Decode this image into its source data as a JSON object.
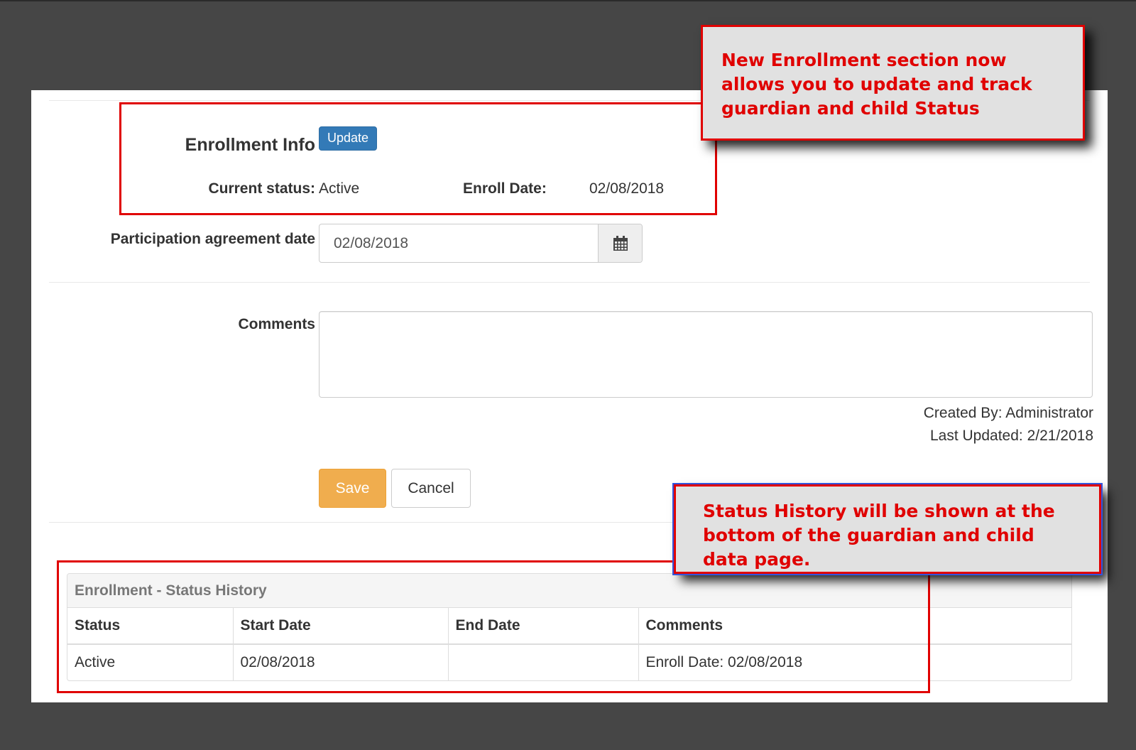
{
  "enrollment": {
    "title": "Enrollment Info",
    "update_label": "Update",
    "current_status_label": "Current status:",
    "current_status_value": "Active",
    "enroll_date_label": "Enroll Date:",
    "enroll_date_value": "02/08/2018"
  },
  "participation": {
    "label": "Participation agreement date",
    "value": "02/08/2018",
    "icon": "calendar-icon"
  },
  "comments": {
    "label": "Comments",
    "value": ""
  },
  "meta": {
    "created_by": "Created By: Administrator",
    "last_updated": "Last Updated: 2/21/2018"
  },
  "actions": {
    "save_label": "Save",
    "cancel_label": "Cancel"
  },
  "history": {
    "title": "Enrollment - Status History",
    "columns": [
      "Status",
      "Start Date",
      "End Date",
      "Comments"
    ],
    "rows": [
      [
        "Active",
        "02/08/2018",
        "",
        "Enroll Date: 02/08/2018"
      ]
    ]
  },
  "callouts": {
    "enrollment_note": "New Enrollment section now allows you to update and track guardian and child Status",
    "history_note": "Status History will be shown at the bottom of the guardian and child data page."
  },
  "colors": {
    "primary": "#337ab7",
    "warning": "#f0ad4e",
    "annotation_red": "#e00000",
    "backdrop": "#464646"
  }
}
